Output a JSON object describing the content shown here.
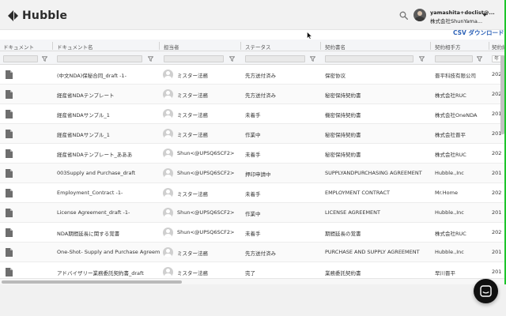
{
  "app": {
    "name": "Hubble"
  },
  "user": {
    "email": "yamashita+doclist@...",
    "company": "株式会社ShunYama..."
  },
  "actions": {
    "csv_download": "CSV ダウンロード"
  },
  "columns": [
    {
      "label": "ドキュメント"
    },
    {
      "label": "ドキュメント名"
    },
    {
      "label": "担当者"
    },
    {
      "label": "ステータス"
    },
    {
      "label": "契約書名"
    },
    {
      "label": "契約相手方"
    },
    {
      "label": "契約締"
    }
  ],
  "filters": {
    "date_placeholder": "年 /"
  },
  "rows": [
    {
      "doc_name": "(中文NDA)保秘合同_draft -1-",
      "assignee": "ミスター法務",
      "status": "先方送付済み",
      "contract_name": "保密协议",
      "counterparty": "晋平科技有限公司",
      "date": "202"
    },
    {
      "doc_name": "経産省NDAテンプレート",
      "assignee": "ミスター法務",
      "status": "先方送付済み",
      "contract_name": "秘密保持契約書",
      "counterparty": "株式会社RUC",
      "date": "202"
    },
    {
      "doc_name": "経産省NDAサンプル_1",
      "assignee": "ミスター法務",
      "status": "未着手",
      "contract_name": "機密保持契約書",
      "counterparty": "株式会社OneNDA",
      "date": "201"
    },
    {
      "doc_name": "経産省NDAサンプル_1",
      "assignee": "ミスター法務",
      "status": "作業中",
      "contract_name": "秘密保持契約書",
      "counterparty": "株式会社晋平",
      "date": "201"
    },
    {
      "doc_name": "経産省NDAテンプレート_あああ",
      "assignee": "Shun<@UPSQ6SCF2>",
      "status": "未着手",
      "contract_name": "秘密保持契約書",
      "counterparty": "株式会社RUC",
      "date": "202"
    },
    {
      "doc_name": "003Supply and Purchase_draft",
      "assignee": "Shun<@UPSQ6SCF2>",
      "status": "押印申請中",
      "contract_name": "SUPPLYANDPURCHASING AGREEMENT",
      "counterparty": "Hubble.,Inc",
      "date": "201"
    },
    {
      "doc_name": "Employment_Contract -1-",
      "assignee": "ミスター法務",
      "status": "未着手",
      "contract_name": "EMPLOYMENT CONTRACT",
      "counterparty": "Mr.Home",
      "date": "202"
    },
    {
      "doc_name": "License Agreement_draft -1-",
      "assignee": "Shun<@UPSQ6SCF2>",
      "status": "作業中",
      "contract_name": "LICENSE AGREEMENT",
      "counterparty": "Hubble.,Inc",
      "date": "201"
    },
    {
      "doc_name": "NDA期間延長に関する覚書",
      "assignee": "Shun<@UPSQ6SCF2>",
      "status": "未着手",
      "contract_name": "期間延長の覚書",
      "counterparty": "株式会社RUC",
      "date": "202"
    },
    {
      "doc_name": "One-Shot- Supply and Purchase Agreement",
      "assignee": "ミスター法務",
      "status": "先方送付済み",
      "contract_name": "PURCHASE AND SUPPLY AGREEMENT",
      "counterparty": "Hubble.,Inc",
      "date": "201"
    },
    {
      "doc_name": "アドバイザリー業務委託契約書_draft",
      "assignee": "ミスター法務",
      "status": "完了",
      "contract_name": "業務委託契約書",
      "counterparty": "早川晋平",
      "date": "201"
    }
  ],
  "colors": {
    "accent": "#2e63b8",
    "edge": "#1dc42b"
  }
}
